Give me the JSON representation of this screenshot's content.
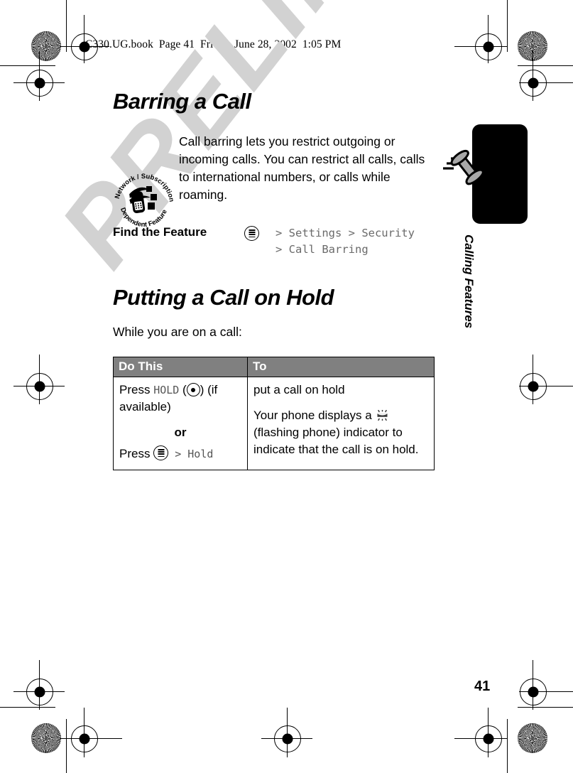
{
  "page": {
    "header_line": "C330.UG.book  Page 41  Friday, June 28, 2002  1:05 PM",
    "number": "41",
    "watermark": "PRELIMINARY",
    "side_tab_label": "Calling Features"
  },
  "sections": [
    {
      "title": "Barring a Call",
      "badge_icon": "network-subscription-dependent-feature-icon",
      "badge_text_top": "Network / Subscription",
      "badge_text_bottom": "Dependent Feature",
      "body": "Call barring lets you restrict outgoing or incoming calls. You can restrict all calls, calls to international numbers, or calls while roaming.",
      "find_feature": {
        "label": "Find the Feature",
        "key_icon": "menu-key-icon",
        "path_line_1": "> Settings > Security",
        "path_line_2": "> Call Barring"
      }
    },
    {
      "title": "Putting a Call on Hold",
      "intro": "While you are on a call:",
      "table": {
        "headers": [
          "Do This",
          "To"
        ],
        "rows": [
          {
            "do_this": {
              "press_1_prefix": "Press ",
              "press_1_softkey": "HOLD",
              "press_1_suffix": " (if available)",
              "select_key_icon": "center-select-key-icon",
              "or": "or",
              "press_2_prefix": "Press ",
              "menu_key_icon": "menu-key-icon",
              "press_2_gt": " > ",
              "press_2_item": "Hold"
            },
            "to": {
              "line_1": "put a call on hold",
              "line_2_prefix": "Your phone displays a ",
              "indicator_icon": "flashing-phone-indicator-icon",
              "line_2_suffix": " (flashing phone) indicator to indicate that the call is on hold."
            }
          }
        ]
      }
    }
  ],
  "colors": {
    "table_header_bg": "#808080",
    "mono_text": "#6a6a6a",
    "watermark": "#d2d2d2",
    "side_tab": "#000000",
    "handset": "#a8a8a8"
  }
}
